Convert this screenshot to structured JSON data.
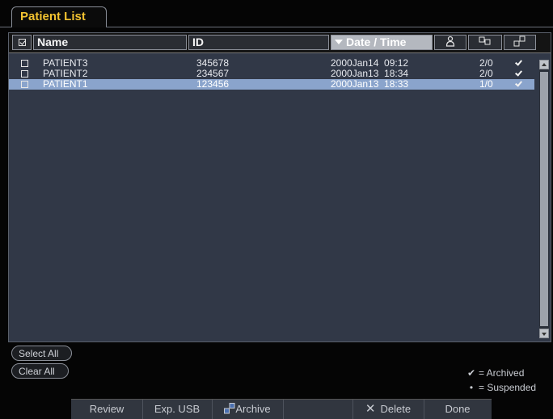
{
  "tab": {
    "title": "Patient List"
  },
  "columns": {
    "name": "Name",
    "id": "ID",
    "date": "Date / Time",
    "patient_icon": "patient-icon",
    "images_icon": "images-icon",
    "archive_icon": "archive-icon"
  },
  "rows": [
    {
      "name": "PATIENT3",
      "id": "345678",
      "date": "2000Jan14  09:12",
      "count": "2/0",
      "archived": true
    },
    {
      "name": "PATIENT2",
      "id": "234567",
      "date": "2000Jan13  18:34",
      "count": "2/0",
      "archived": true
    },
    {
      "name": "PATIENT1",
      "id": "123456",
      "date": "2000Jan13  18:33",
      "count": "1/0",
      "archived": true,
      "selected": true
    }
  ],
  "buttons": {
    "select_all": "Select All",
    "clear_all": "Clear All",
    "review": "Review",
    "exp_usb": "Exp. USB",
    "archive": "Archive",
    "delete": "Delete",
    "done": "Done"
  },
  "legend": {
    "archived": "= Archived",
    "suspended": "= Suspended"
  },
  "colors": {
    "tab_title": "#f2c230",
    "list_bg": "#313847",
    "selected_row": "#8aa4cc",
    "sorted_header": "#b4b8bf"
  }
}
